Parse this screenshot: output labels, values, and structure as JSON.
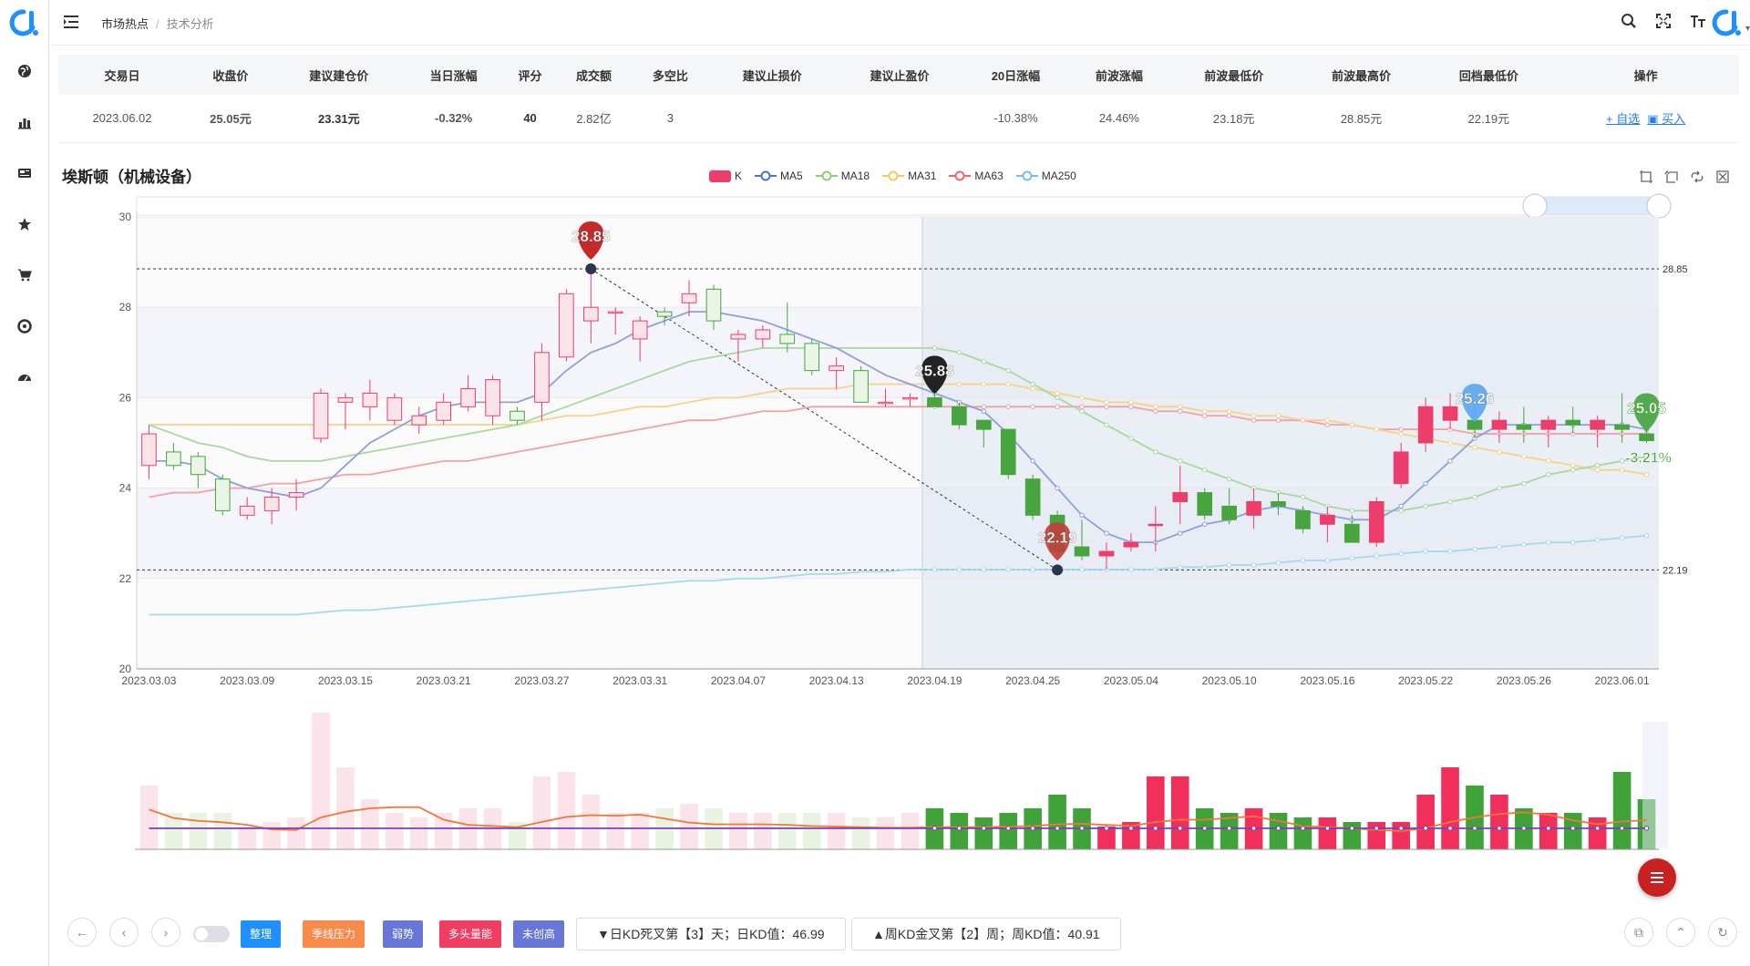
{
  "header": {
    "breadcrumb": [
      "市场热点",
      "技术分析"
    ]
  },
  "sidebar": {
    "icons": [
      "globe-icon",
      "bar-chart-icon",
      "newspaper-icon",
      "star-icon",
      "cart-icon",
      "target-icon",
      "dashboard-icon"
    ]
  },
  "table": {
    "headers": [
      "交易日",
      "收盘价",
      "建议建仓价",
      "当日涨幅",
      "评分",
      "成交额",
      "多空比",
      "建议止损价",
      "建议止盈价",
      "20日涨幅",
      "前波涨幅",
      "前波最低价",
      "前波最高价",
      "回档最低价",
      "操作"
    ],
    "row": {
      "date": "2023.06.02",
      "close": "25.05元",
      "build_price": "23.31元",
      "daily_change": "-0.32%",
      "score": "40",
      "turnover": "2.82亿",
      "long_short": "3",
      "stop_loss": "",
      "take_profit": "",
      "change_20d": "-10.38%",
      "prev_wave_change": "24.46%",
      "prev_wave_low": "23.18元",
      "prev_wave_high": "28.85元",
      "pullback_low": "22.19元",
      "op_add": "自选",
      "op_buy": "买入"
    }
  },
  "chart_title": "埃斯顿（机械设备）",
  "legend": [
    "K",
    "MA5",
    "MA18",
    "MA31",
    "MA63",
    "MA250"
  ],
  "colors": {
    "up": "#ec3d6b",
    "down": "#47a43f",
    "ma5": "#8fa0d8",
    "ma18": "#a8d8a0",
    "ma31": "#f7d08a",
    "ma63": "#f1a0a8",
    "ma250": "#a8d8ec",
    "accent": "#1e7cf5"
  },
  "chart_data": {
    "type": "candlestick",
    "ylim": [
      20,
      30
    ],
    "yticks": [
      20,
      22,
      24,
      26,
      28,
      30
    ],
    "xtick_labels": [
      "2023.03.03",
      "2023.03.09",
      "2023.03.15",
      "2023.03.21",
      "2023.03.27",
      "2023.03.31",
      "2023.04.07",
      "2023.04.13",
      "2023.04.19",
      "2023.04.25",
      "2023.05.04",
      "2023.05.10",
      "2023.05.16",
      "2023.05.22",
      "2023.05.26",
      "2023.06.01"
    ],
    "ohlc": [
      [
        24.5,
        25.2,
        24.2,
        25.4
      ],
      [
        24.8,
        24.5,
        24.4,
        25.0
      ],
      [
        24.7,
        24.3,
        24.0,
        24.8
      ],
      [
        24.2,
        23.5,
        23.4,
        24.3
      ],
      [
        23.4,
        23.6,
        23.3,
        23.8
      ],
      [
        23.5,
        23.8,
        23.2,
        24.0
      ],
      [
        23.8,
        23.9,
        23.5,
        24.2
      ],
      [
        25.1,
        26.1,
        25.0,
        26.2
      ],
      [
        25.9,
        26.0,
        25.3,
        26.1
      ],
      [
        25.8,
        26.1,
        25.5,
        26.4
      ],
      [
        25.5,
        26.0,
        25.4,
        26.1
      ],
      [
        25.4,
        25.6,
        25.2,
        25.8
      ],
      [
        25.5,
        25.9,
        25.4,
        26.1
      ],
      [
        25.8,
        26.2,
        25.7,
        26.5
      ],
      [
        25.6,
        26.4,
        25.4,
        26.5
      ],
      [
        25.7,
        25.5,
        25.4,
        25.8
      ],
      [
        25.9,
        27.0,
        25.5,
        27.2
      ],
      [
        26.9,
        28.3,
        26.8,
        28.4
      ],
      [
        27.7,
        28.0,
        27.2,
        28.85
      ],
      [
        27.9,
        27.9,
        27.4,
        28.0
      ],
      [
        27.3,
        27.7,
        26.8,
        27.8
      ],
      [
        27.9,
        27.8,
        27.6,
        28.0
      ],
      [
        28.1,
        28.3,
        27.8,
        28.6
      ],
      [
        28.4,
        27.7,
        27.5,
        28.5
      ],
      [
        27.3,
        27.4,
        26.8,
        27.5
      ],
      [
        27.3,
        27.5,
        27.1,
        27.6
      ],
      [
        27.4,
        27.2,
        27.0,
        28.1
      ],
      [
        27.2,
        26.6,
        26.5,
        27.3
      ],
      [
        26.6,
        26.7,
        26.2,
        26.9
      ],
      [
        26.6,
        25.9,
        25.9,
        26.7
      ],
      [
        25.9,
        25.9,
        25.8,
        26.2
      ],
      [
        26.0,
        26.0,
        25.8,
        26.1
      ],
      [
        26.0,
        25.8,
        25.8,
        26.3
      ],
      [
        25.8,
        25.4,
        25.3,
        25.9
      ],
      [
        25.5,
        25.3,
        24.9,
        25.5
      ],
      [
        25.3,
        24.3,
        24.2,
        25.3
      ],
      [
        24.2,
        23.4,
        23.3,
        24.3
      ],
      [
        23.4,
        22.6,
        22.5,
        23.5
      ],
      [
        22.7,
        22.5,
        22.4,
        23.3
      ],
      [
        22.5,
        22.6,
        22.19,
        22.8
      ],
      [
        22.7,
        22.8,
        22.6,
        23.0
      ],
      [
        23.2,
        23.2,
        22.6,
        23.6
      ],
      [
        23.7,
        23.9,
        23.2,
        24.5
      ],
      [
        23.9,
        23.4,
        23.3,
        24.0
      ],
      [
        23.6,
        23.3,
        23.2,
        24.0
      ],
      [
        23.4,
        23.7,
        23.1,
        24.0
      ],
      [
        23.7,
        23.6,
        23.4,
        23.9
      ],
      [
        23.5,
        23.1,
        23.0,
        23.6
      ],
      [
        23.2,
        23.4,
        22.8,
        23.6
      ],
      [
        23.2,
        22.8,
        22.8,
        23.4
      ],
      [
        22.8,
        23.7,
        22.7,
        23.8
      ],
      [
        24.1,
        24.8,
        24.0,
        25.0
      ],
      [
        25.0,
        25.8,
        24.8,
        26.0
      ],
      [
        25.5,
        25.8,
        25.3,
        26.1
      ],
      [
        25.5,
        25.3,
        25.1,
        25.8
      ],
      [
        25.3,
        25.5,
        25.0,
        25.7
      ],
      [
        25.4,
        25.3,
        25.0,
        25.8
      ],
      [
        25.3,
        25.5,
        24.9,
        25.6
      ],
      [
        25.5,
        25.4,
        25.2,
        25.8
      ],
      [
        25.3,
        25.5,
        24.9,
        25.6
      ],
      [
        25.4,
        25.3,
        25.0,
        26.1
      ],
      [
        25.2,
        25.05,
        25.0,
        25.3
      ]
    ],
    "ma5": [
      24.6,
      24.6,
      24.5,
      24.2,
      24.0,
      23.9,
      23.8,
      24.0,
      24.5,
      25.0,
      25.3,
      25.6,
      25.8,
      25.9,
      25.9,
      25.9,
      26.1,
      26.6,
      27.0,
      27.2,
      27.5,
      27.7,
      27.9,
      27.9,
      27.8,
      27.7,
      27.5,
      27.3,
      27.1,
      26.8,
      26.5,
      26.3,
      26.1,
      25.9,
      25.7,
      25.2,
      24.6,
      24.0,
      23.4,
      23.0,
      22.8,
      22.8,
      23.0,
      23.2,
      23.3,
      23.5,
      23.6,
      23.5,
      23.4,
      23.3,
      23.3,
      23.6,
      24.1,
      24.6,
      25.1,
      25.4,
      25.4,
      25.4,
      25.4,
      25.4,
      25.4,
      25.3
    ],
    "ma18": [
      25.4,
      25.2,
      25.0,
      24.9,
      24.7,
      24.6,
      24.6,
      24.6,
      24.7,
      24.8,
      24.9,
      25.0,
      25.1,
      25.2,
      25.3,
      25.4,
      25.6,
      25.8,
      26.0,
      26.2,
      26.4,
      26.6,
      26.8,
      26.9,
      27.0,
      27.1,
      27.1,
      27.1,
      27.1,
      27.1,
      27.1,
      27.1,
      27.1,
      27.0,
      26.8,
      26.6,
      26.3,
      26.0,
      25.7,
      25.4,
      25.1,
      24.8,
      24.6,
      24.4,
      24.2,
      24.0,
      23.9,
      23.8,
      23.6,
      23.5,
      23.5,
      23.5,
      23.6,
      23.7,
      23.8,
      24.0,
      24.1,
      24.3,
      24.4,
      24.5,
      24.6,
      24.7
    ],
    "ma31": [
      25.4,
      25.4,
      25.4,
      25.4,
      25.4,
      25.4,
      25.4,
      25.4,
      25.4,
      25.4,
      25.4,
      25.4,
      25.4,
      25.4,
      25.4,
      25.4,
      25.5,
      25.6,
      25.6,
      25.7,
      25.8,
      25.8,
      25.9,
      26.0,
      26.0,
      26.1,
      26.2,
      26.2,
      26.2,
      26.3,
      26.3,
      26.3,
      26.3,
      26.3,
      26.3,
      26.3,
      26.2,
      26.1,
      26.0,
      25.9,
      25.9,
      25.8,
      25.8,
      25.7,
      25.7,
      25.6,
      25.6,
      25.5,
      25.5,
      25.4,
      25.3,
      25.2,
      25.1,
      25.0,
      24.9,
      24.8,
      24.7,
      24.6,
      24.5,
      24.4,
      24.4,
      24.3
    ],
    "ma63": [
      23.8,
      23.9,
      23.9,
      24.0,
      24.0,
      24.1,
      24.1,
      24.2,
      24.3,
      24.3,
      24.4,
      24.5,
      24.6,
      24.6,
      24.7,
      24.8,
      24.9,
      25.0,
      25.1,
      25.2,
      25.3,
      25.4,
      25.5,
      25.5,
      25.6,
      25.7,
      25.7,
      25.8,
      25.8,
      25.8,
      25.8,
      25.8,
      25.8,
      25.8,
      25.8,
      25.8,
      25.8,
      25.8,
      25.8,
      25.8,
      25.8,
      25.7,
      25.7,
      25.6,
      25.6,
      25.5,
      25.5,
      25.5,
      25.4,
      25.4,
      25.3,
      25.3,
      25.3,
      25.3,
      25.2,
      25.2,
      25.2,
      25.2,
      25.2,
      25.2,
      25.2,
      25.2
    ],
    "ma250": [
      21.2,
      21.2,
      21.2,
      21.2,
      21.2,
      21.2,
      21.2,
      21.25,
      21.3,
      21.3,
      21.35,
      21.4,
      21.45,
      21.5,
      21.55,
      21.6,
      21.65,
      21.7,
      21.75,
      21.8,
      21.85,
      21.9,
      21.95,
      21.95,
      22.0,
      22.0,
      22.05,
      22.1,
      22.1,
      22.15,
      22.15,
      22.2,
      22.2,
      22.2,
      22.2,
      22.2,
      22.2,
      22.2,
      22.2,
      22.2,
      22.2,
      22.2,
      22.25,
      22.25,
      22.3,
      22.3,
      22.35,
      22.4,
      22.4,
      22.45,
      22.5,
      22.55,
      22.6,
      22.6,
      22.65,
      22.7,
      22.75,
      22.8,
      22.8,
      22.85,
      22.9,
      22.95
    ],
    "volume_rel": [
      0.7,
      0.4,
      0.4,
      0.4,
      0.25,
      0.3,
      0.35,
      1.5,
      0.9,
      0.55,
      0.4,
      0.35,
      0.4,
      0.45,
      0.45,
      0.3,
      0.8,
      0.85,
      0.6,
      0.4,
      0.4,
      0.45,
      0.5,
      0.45,
      0.4,
      0.4,
      0.4,
      0.4,
      0.4,
      0.35,
      0.35,
      0.4,
      0.45,
      0.4,
      0.35,
      0.4,
      0.45,
      0.6,
      0.45,
      0.25,
      0.3,
      0.8,
      0.8,
      0.45,
      0.4,
      0.45,
      0.4,
      0.35,
      0.35,
      0.3,
      0.3,
      0.3,
      0.6,
      0.9,
      0.7,
      0.6,
      0.45,
      0.4,
      0.4,
      0.35,
      0.85,
      0.55
    ],
    "highlight_start_index": 32,
    "marks": [
      {
        "label": "28.85",
        "type": "high",
        "index": 18,
        "value": 28.85
      },
      {
        "label": "25.88",
        "type": "mark",
        "index": 32,
        "value": 25.88
      },
      {
        "label": "22.19",
        "type": "low",
        "index": 37,
        "value": 22.19
      },
      {
        "label": "25.26",
        "type": "mark",
        "index": 54,
        "value": 25.26
      },
      {
        "label": "25.05",
        "type": "current",
        "index": 61,
        "value": 25.05
      },
      {
        "label": "-3.21%",
        "type": "current",
        "index": 61,
        "value": 25.05
      }
    ],
    "hlines": [
      {
        "value": 28.85,
        "label": "28.85"
      },
      {
        "value": 22.19,
        "label": "22.19"
      }
    ]
  },
  "bottom": {
    "tags": [
      {
        "label": "整理",
        "color": "#1e90ff"
      },
      {
        "label": "季线压力",
        "color": "#f98a4a"
      },
      {
        "label": "弱势",
        "color": "#6876d8"
      },
      {
        "label": "多头量能",
        "color": "#f03d61"
      },
      {
        "label": "未创高",
        "color": "#6876d8"
      }
    ],
    "daily_kd": "▼日KD死叉第【3】天；日KD值：46.99",
    "weekly_kd": "▲周KD金叉第【2】周；周KD值：40.91"
  }
}
